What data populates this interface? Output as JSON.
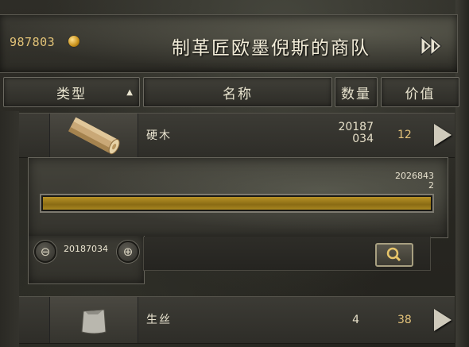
{
  "header": {
    "gold": "987803",
    "caravan_title": "制革匠欧墨倪斯的商队"
  },
  "columns": {
    "type": "类型",
    "name": "名称",
    "quantity": "数量",
    "value": "价值"
  },
  "items": [
    {
      "name": "硬木",
      "quantity_line1": "20187",
      "quantity_line2": "034",
      "value": "12",
      "icon": "wood-log-icon"
    },
    {
      "name": "生丝",
      "quantity": "4",
      "value": "38",
      "icon": "silk-bag-icon"
    }
  ],
  "detail": {
    "total_line1": "2026843",
    "total_line2": "2",
    "selected_amount": "20187034",
    "fill_fraction": 1.0
  },
  "colors": {
    "gold_text": "#e1c277",
    "bar_fill": "#b89226",
    "title_text": "#f2ecd8"
  }
}
